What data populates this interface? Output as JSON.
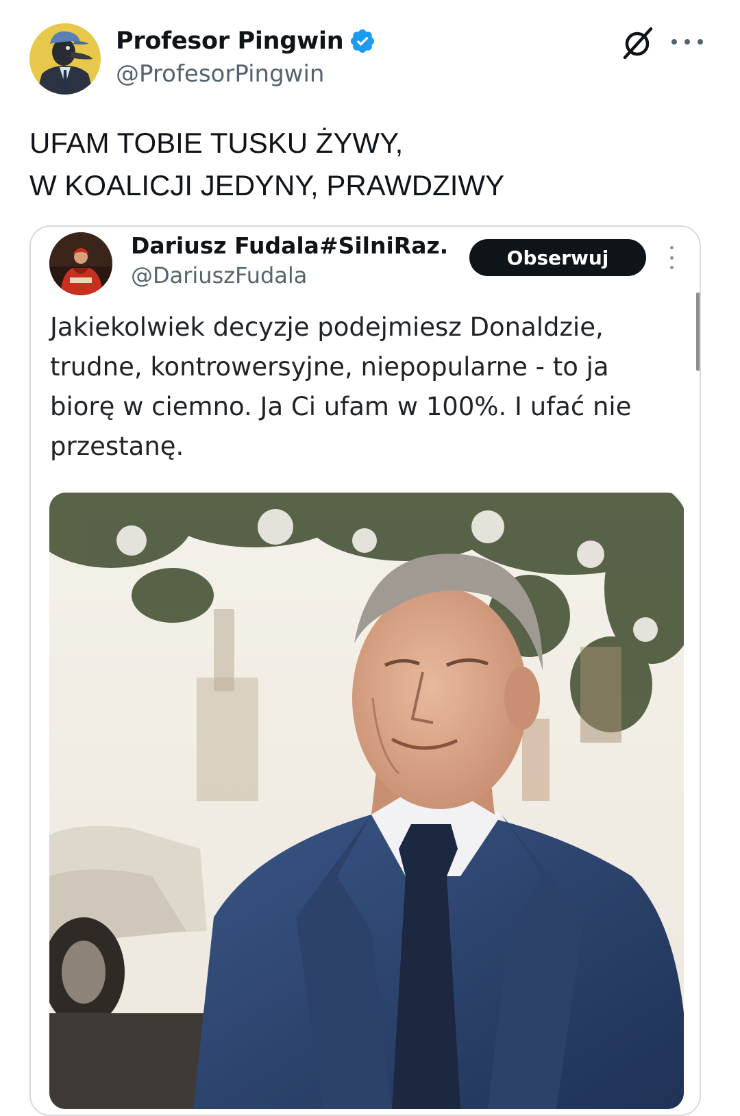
{
  "post": {
    "author": {
      "name": "Profesor Pingwin",
      "handle": "@ProfesorPingwin",
      "verified": true,
      "avatar_icon": "penguin-avatar"
    },
    "text_lines": [
      "UFAM TOBIE TUSKU ŻYWY,",
      "W KOALICJI JEDYNY, PRAWDZIWY"
    ]
  },
  "quoted": {
    "author": {
      "name": "Dariusz Fudala#SilniRaz...",
      "handle": "@DariuszFudala",
      "avatar_icon": "red-figure-avatar"
    },
    "follow_label": "Obserwuj",
    "text_lines": [
      "Jakiekolwiek decyzje podejmiesz Donaldzie,",
      "trudne, kontrowersyjne, niepopularne - to ja",
      "biorę w ciemno. Ja Ci ufam w 100%. I ufać nie",
      "przestanę."
    ],
    "media": {
      "kind": "photo",
      "icon": "man-in-suit-photo"
    }
  },
  "icons": {
    "verified": "verified-badge-icon",
    "grok": "grok-icon",
    "more": "more-icon"
  },
  "colors": {
    "verified_blue": "#1d9bf0",
    "text_primary": "#0f1419",
    "text_secondary": "#536471",
    "border": "#d6dbe0",
    "button_bg": "#0f1419",
    "button_text": "#ffffff"
  }
}
